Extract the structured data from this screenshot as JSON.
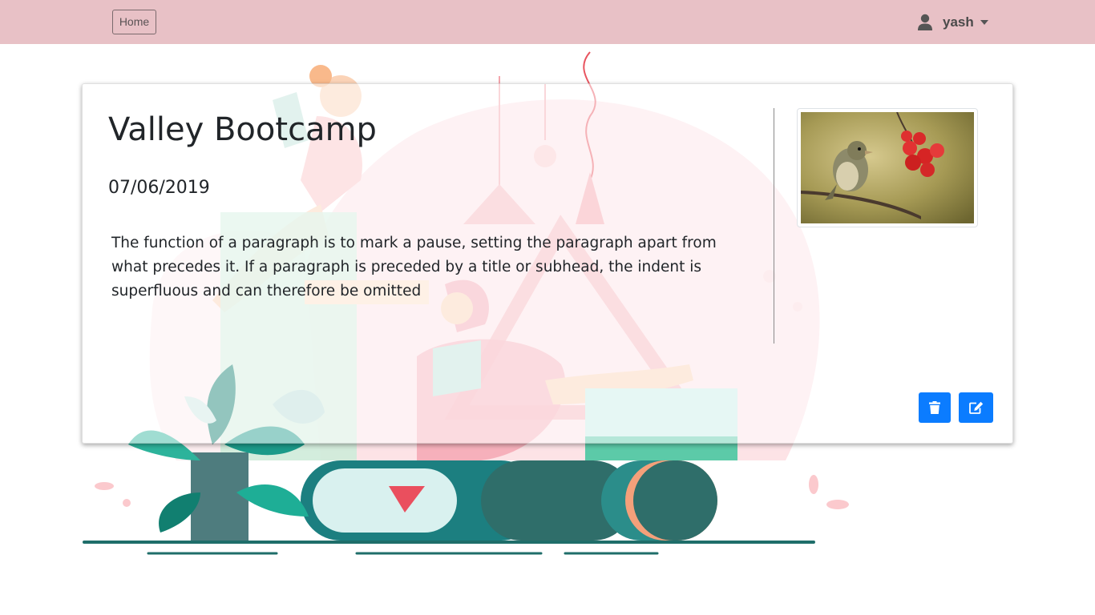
{
  "navbar": {
    "home_label": "Home",
    "user_name": "yash",
    "background_color": "#e8c1c6"
  },
  "card": {
    "title": "Valley Bootcamp",
    "date": "07/06/2019",
    "description": "The function of a paragraph is to mark a pause, setting the paragraph apart from what precedes it. If a paragraph is preceded by a title or subhead, the indent is superfluous and can therefore be omitted",
    "actions": {
      "delete_icon": "trash-icon",
      "edit_icon": "edit-icon",
      "button_color": "#0b7cff"
    }
  },
  "icons": {
    "user": "user-icon",
    "caret": "caret-down-icon"
  }
}
